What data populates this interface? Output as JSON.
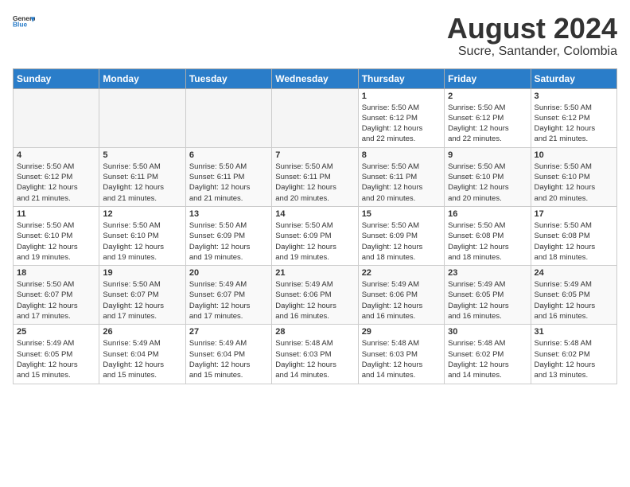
{
  "header": {
    "logo_line1": "General",
    "logo_line2": "Blue",
    "month_year": "August 2024",
    "location": "Sucre, Santander, Colombia"
  },
  "weekdays": [
    "Sunday",
    "Monday",
    "Tuesday",
    "Wednesday",
    "Thursday",
    "Friday",
    "Saturday"
  ],
  "weeks": [
    [
      {
        "day": "",
        "info": ""
      },
      {
        "day": "",
        "info": ""
      },
      {
        "day": "",
        "info": ""
      },
      {
        "day": "",
        "info": ""
      },
      {
        "day": "1",
        "info": "Sunrise: 5:50 AM\nSunset: 6:12 PM\nDaylight: 12 hours\nand 22 minutes."
      },
      {
        "day": "2",
        "info": "Sunrise: 5:50 AM\nSunset: 6:12 PM\nDaylight: 12 hours\nand 22 minutes."
      },
      {
        "day": "3",
        "info": "Sunrise: 5:50 AM\nSunset: 6:12 PM\nDaylight: 12 hours\nand 21 minutes."
      }
    ],
    [
      {
        "day": "4",
        "info": "Sunrise: 5:50 AM\nSunset: 6:12 PM\nDaylight: 12 hours\nand 21 minutes."
      },
      {
        "day": "5",
        "info": "Sunrise: 5:50 AM\nSunset: 6:11 PM\nDaylight: 12 hours\nand 21 minutes."
      },
      {
        "day": "6",
        "info": "Sunrise: 5:50 AM\nSunset: 6:11 PM\nDaylight: 12 hours\nand 21 minutes."
      },
      {
        "day": "7",
        "info": "Sunrise: 5:50 AM\nSunset: 6:11 PM\nDaylight: 12 hours\nand 20 minutes."
      },
      {
        "day": "8",
        "info": "Sunrise: 5:50 AM\nSunset: 6:11 PM\nDaylight: 12 hours\nand 20 minutes."
      },
      {
        "day": "9",
        "info": "Sunrise: 5:50 AM\nSunset: 6:10 PM\nDaylight: 12 hours\nand 20 minutes."
      },
      {
        "day": "10",
        "info": "Sunrise: 5:50 AM\nSunset: 6:10 PM\nDaylight: 12 hours\nand 20 minutes."
      }
    ],
    [
      {
        "day": "11",
        "info": "Sunrise: 5:50 AM\nSunset: 6:10 PM\nDaylight: 12 hours\nand 19 minutes."
      },
      {
        "day": "12",
        "info": "Sunrise: 5:50 AM\nSunset: 6:10 PM\nDaylight: 12 hours\nand 19 minutes."
      },
      {
        "day": "13",
        "info": "Sunrise: 5:50 AM\nSunset: 6:09 PM\nDaylight: 12 hours\nand 19 minutes."
      },
      {
        "day": "14",
        "info": "Sunrise: 5:50 AM\nSunset: 6:09 PM\nDaylight: 12 hours\nand 19 minutes."
      },
      {
        "day": "15",
        "info": "Sunrise: 5:50 AM\nSunset: 6:09 PM\nDaylight: 12 hours\nand 18 minutes."
      },
      {
        "day": "16",
        "info": "Sunrise: 5:50 AM\nSunset: 6:08 PM\nDaylight: 12 hours\nand 18 minutes."
      },
      {
        "day": "17",
        "info": "Sunrise: 5:50 AM\nSunset: 6:08 PM\nDaylight: 12 hours\nand 18 minutes."
      }
    ],
    [
      {
        "day": "18",
        "info": "Sunrise: 5:50 AM\nSunset: 6:07 PM\nDaylight: 12 hours\nand 17 minutes."
      },
      {
        "day": "19",
        "info": "Sunrise: 5:50 AM\nSunset: 6:07 PM\nDaylight: 12 hours\nand 17 minutes."
      },
      {
        "day": "20",
        "info": "Sunrise: 5:49 AM\nSunset: 6:07 PM\nDaylight: 12 hours\nand 17 minutes."
      },
      {
        "day": "21",
        "info": "Sunrise: 5:49 AM\nSunset: 6:06 PM\nDaylight: 12 hours\nand 16 minutes."
      },
      {
        "day": "22",
        "info": "Sunrise: 5:49 AM\nSunset: 6:06 PM\nDaylight: 12 hours\nand 16 minutes."
      },
      {
        "day": "23",
        "info": "Sunrise: 5:49 AM\nSunset: 6:05 PM\nDaylight: 12 hours\nand 16 minutes."
      },
      {
        "day": "24",
        "info": "Sunrise: 5:49 AM\nSunset: 6:05 PM\nDaylight: 12 hours\nand 16 minutes."
      }
    ],
    [
      {
        "day": "25",
        "info": "Sunrise: 5:49 AM\nSunset: 6:05 PM\nDaylight: 12 hours\nand 15 minutes."
      },
      {
        "day": "26",
        "info": "Sunrise: 5:49 AM\nSunset: 6:04 PM\nDaylight: 12 hours\nand 15 minutes."
      },
      {
        "day": "27",
        "info": "Sunrise: 5:49 AM\nSunset: 6:04 PM\nDaylight: 12 hours\nand 15 minutes."
      },
      {
        "day": "28",
        "info": "Sunrise: 5:48 AM\nSunset: 6:03 PM\nDaylight: 12 hours\nand 14 minutes."
      },
      {
        "day": "29",
        "info": "Sunrise: 5:48 AM\nSunset: 6:03 PM\nDaylight: 12 hours\nand 14 minutes."
      },
      {
        "day": "30",
        "info": "Sunrise: 5:48 AM\nSunset: 6:02 PM\nDaylight: 12 hours\nand 14 minutes."
      },
      {
        "day": "31",
        "info": "Sunrise: 5:48 AM\nSunset: 6:02 PM\nDaylight: 12 hours\nand 13 minutes."
      }
    ]
  ]
}
